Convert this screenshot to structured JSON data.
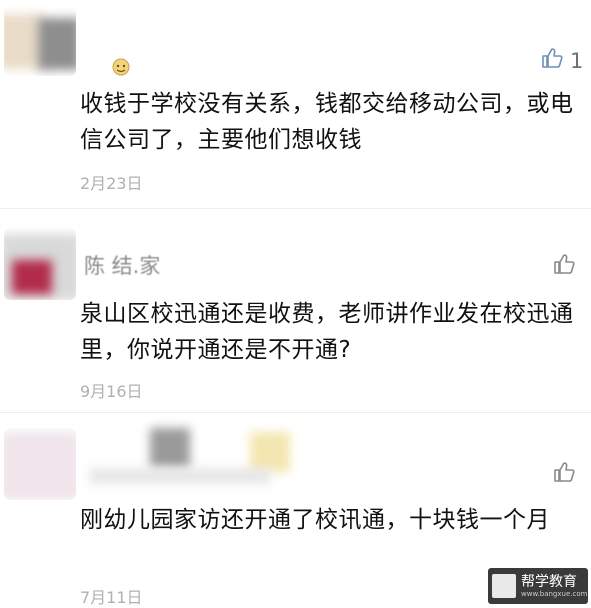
{
  "comments": [
    {
      "text": "收钱于学校没有关系，钱都交给移动公司，或电信公司了，主要他们想收钱",
      "date": "2月23日",
      "likes": "1",
      "nickname": ""
    },
    {
      "text": "泉山区校迅通还是收费，老师讲作业发在校迅通里，你说开通还是不开通?",
      "date": "9月16日",
      "likes": "",
      "nickname": "陈    结.家"
    },
    {
      "text": "刚幼儿园家访还开通了校讯通，十块钱一个月",
      "date": "7月11日",
      "likes": "",
      "nickname": ""
    }
  ],
  "watermark": {
    "text": "帮学教育",
    "subtext": "www.bangxue.com"
  },
  "colors": {
    "text": "#111111",
    "date": "#b0b0b0",
    "icon": "#8a8a8a"
  },
  "icons": [
    "thumbs-up-icon",
    "emoji-icon"
  ]
}
